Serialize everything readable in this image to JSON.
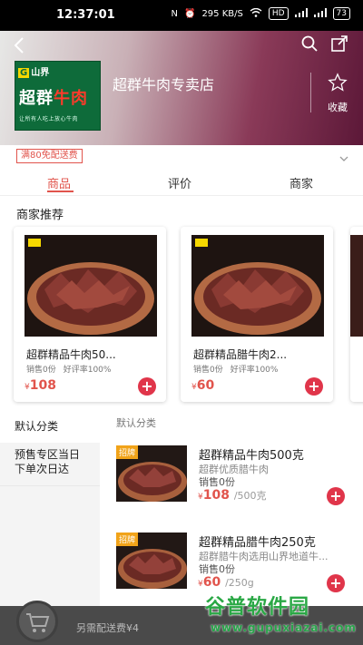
{
  "status_bar": {
    "time": "12:37:01",
    "network_speed": "295 KB/S",
    "network_label": "HD",
    "battery": "73"
  },
  "store": {
    "name": "超群牛肉专卖店",
    "logo_brand": "山界",
    "logo_title_part1": "超群",
    "logo_title_part2": "牛肉",
    "logo_tagline": "让所有人吃上放心牛肉",
    "favorite_label": "收藏"
  },
  "promo": {
    "badge": "满80免配送费"
  },
  "tabs": [
    {
      "label": "商品",
      "active": true
    },
    {
      "label": "评价",
      "active": false
    },
    {
      "label": "商家",
      "active": false
    }
  ],
  "recommend": {
    "title": "商家推荐",
    "items": [
      {
        "name": "超群精品牛肉50...",
        "sales": "销售0份",
        "rating": "好评率100%",
        "currency": "¥",
        "price": "108"
      },
      {
        "name": "超群精品腊牛肉2...",
        "sales": "销售0份",
        "rating": "好评率100%",
        "currency": "¥",
        "price": "60"
      }
    ]
  },
  "categories": [
    {
      "label": "默认分类",
      "active": true
    },
    {
      "label": "预售专区当日下单次日达",
      "active": false
    }
  ],
  "product_section": {
    "label": "默认分类",
    "products": [
      {
        "tag": "招牌",
        "name": "超群精品牛肉500克",
        "desc": "超群优质腊牛肉",
        "sales": "销售0份",
        "currency": "¥",
        "price": "108",
        "unit": "/500克"
      },
      {
        "tag": "招牌",
        "name": "超群精品腊牛肉250克",
        "desc": "超群腊牛肉选用山界地道牛...",
        "sales": "销售0份",
        "currency": "¥",
        "price": "60",
        "unit": "/250g"
      }
    ]
  },
  "cart": {
    "delivery_text": "另需配送费¥4"
  },
  "watermark": {
    "main": "谷普软件园",
    "url": "www.gupuxiazai.com"
  },
  "colors": {
    "accent": "#e1544c",
    "add_button": "#e0354a"
  }
}
